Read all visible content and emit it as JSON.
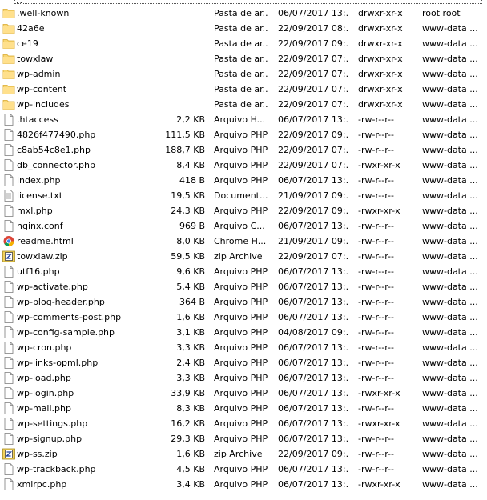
{
  "parent": {
    "label": ".."
  },
  "files": [
    {
      "name": ".well-known",
      "size": "",
      "type": "Pasta de ar...",
      "date": "06/07/2017 13:...",
      "perm": "drwxr-xr-x",
      "owner": "root root",
      "icon": "folder"
    },
    {
      "name": "42a6e",
      "size": "",
      "type": "Pasta de ar...",
      "date": "22/09/2017 08:...",
      "perm": "drwxr-xr-x",
      "owner": "www-data ...",
      "icon": "folder"
    },
    {
      "name": "ce19",
      "size": "",
      "type": "Pasta de ar...",
      "date": "22/09/2017 09:...",
      "perm": "drwxr-xr-x",
      "owner": "www-data ...",
      "icon": "folder"
    },
    {
      "name": "towxlaw",
      "size": "",
      "type": "Pasta de ar...",
      "date": "22/09/2017 07:...",
      "perm": "drwxr-xr-x",
      "owner": "www-data ...",
      "icon": "folder"
    },
    {
      "name": "wp-admin",
      "size": "",
      "type": "Pasta de ar...",
      "date": "22/09/2017 07:...",
      "perm": "drwxr-xr-x",
      "owner": "www-data ...",
      "icon": "folder"
    },
    {
      "name": "wp-content",
      "size": "",
      "type": "Pasta de ar...",
      "date": "22/09/2017 07:...",
      "perm": "drwxr-xr-x",
      "owner": "www-data ...",
      "icon": "folder"
    },
    {
      "name": "wp-includes",
      "size": "",
      "type": "Pasta de ar...",
      "date": "22/09/2017 07:...",
      "perm": "drwxr-xr-x",
      "owner": "www-data ...",
      "icon": "folder"
    },
    {
      "name": ".htaccess",
      "size": "2,2 KB",
      "type": "Arquivo H...",
      "date": "06/07/2017 13:...",
      "perm": "-rw-r--r--",
      "owner": "www-data ...",
      "icon": "file"
    },
    {
      "name": "4826f477490.php",
      "size": "111,5 KB",
      "type": "Arquivo PHP",
      "date": "22/09/2017 09:...",
      "perm": "-rw-r--r--",
      "owner": "www-data ...",
      "icon": "file"
    },
    {
      "name": "c8ab54c8e1.php",
      "size": "188,7 KB",
      "type": "Arquivo PHP",
      "date": "22/09/2017 07:...",
      "perm": "-rw-r--r--",
      "owner": "www-data ...",
      "icon": "file"
    },
    {
      "name": "db_connector.php",
      "size": "8,4 KB",
      "type": "Arquivo PHP",
      "date": "22/09/2017 07:...",
      "perm": "-rwxr-xr-x",
      "owner": "www-data ...",
      "icon": "file"
    },
    {
      "name": "index.php",
      "size": "418 B",
      "type": "Arquivo PHP",
      "date": "06/07/2017 13:...",
      "perm": "-rw-r--r--",
      "owner": "www-data ...",
      "icon": "file"
    },
    {
      "name": "license.txt",
      "size": "19,5 KB",
      "type": "Document...",
      "date": "21/09/2017 09:...",
      "perm": "-rw-r--r--",
      "owner": "www-data ...",
      "icon": "textfile"
    },
    {
      "name": "mxl.php",
      "size": "24,3 KB",
      "type": "Arquivo PHP",
      "date": "22/09/2017 09:...",
      "perm": "-rwxr-xr-x",
      "owner": "www-data ...",
      "icon": "file"
    },
    {
      "name": "nginx.conf",
      "size": "969 B",
      "type": "Arquivo C...",
      "date": "06/07/2017 13:...",
      "perm": "-rw-r--r--",
      "owner": "www-data ...",
      "icon": "file"
    },
    {
      "name": "readme.html",
      "size": "8,0 KB",
      "type": "Chrome H...",
      "date": "21/09/2017 09:...",
      "perm": "-rw-r--r--",
      "owner": "www-data ...",
      "icon": "chrome"
    },
    {
      "name": "towxlaw.zip",
      "size": "59,5 KB",
      "type": "zip Archive",
      "date": "22/09/2017 07:...",
      "perm": "-rw-r--r--",
      "owner": "www-data ...",
      "icon": "zip"
    },
    {
      "name": "utf16.php",
      "size": "9,6 KB",
      "type": "Arquivo PHP",
      "date": "06/07/2017 13:...",
      "perm": "-rw-r--r--",
      "owner": "www-data ...",
      "icon": "file"
    },
    {
      "name": "wp-activate.php",
      "size": "5,4 KB",
      "type": "Arquivo PHP",
      "date": "06/07/2017 13:...",
      "perm": "-rw-r--r--",
      "owner": "www-data ...",
      "icon": "file"
    },
    {
      "name": "wp-blog-header.php",
      "size": "364 B",
      "type": "Arquivo PHP",
      "date": "06/07/2017 13:...",
      "perm": "-rw-r--r--",
      "owner": "www-data ...",
      "icon": "file"
    },
    {
      "name": "wp-comments-post.php",
      "size": "1,6 KB",
      "type": "Arquivo PHP",
      "date": "06/07/2017 13:...",
      "perm": "-rw-r--r--",
      "owner": "www-data ...",
      "icon": "file"
    },
    {
      "name": "wp-config-sample.php",
      "size": "3,1 KB",
      "type": "Arquivo PHP",
      "date": "04/08/2017 09:...",
      "perm": "-rw-r--r--",
      "owner": "www-data ...",
      "icon": "file"
    },
    {
      "name": "wp-cron.php",
      "size": "3,3 KB",
      "type": "Arquivo PHP",
      "date": "06/07/2017 13:...",
      "perm": "-rw-r--r--",
      "owner": "www-data ...",
      "icon": "file"
    },
    {
      "name": "wp-links-opml.php",
      "size": "2,4 KB",
      "type": "Arquivo PHP",
      "date": "06/07/2017 13:...",
      "perm": "-rw-r--r--",
      "owner": "www-data ...",
      "icon": "file"
    },
    {
      "name": "wp-load.php",
      "size": "3,3 KB",
      "type": "Arquivo PHP",
      "date": "06/07/2017 13:...",
      "perm": "-rw-r--r--",
      "owner": "www-data ...",
      "icon": "file"
    },
    {
      "name": "wp-login.php",
      "size": "33,9 KB",
      "type": "Arquivo PHP",
      "date": "06/07/2017 13:...",
      "perm": "-rwxr-xr-x",
      "owner": "www-data ...",
      "icon": "file"
    },
    {
      "name": "wp-mail.php",
      "size": "8,3 KB",
      "type": "Arquivo PHP",
      "date": "06/07/2017 13:...",
      "perm": "-rw-r--r--",
      "owner": "www-data ...",
      "icon": "file"
    },
    {
      "name": "wp-settings.php",
      "size": "16,2 KB",
      "type": "Arquivo PHP",
      "date": "06/07/2017 13:...",
      "perm": "-rwxr-xr-x",
      "owner": "www-data ...",
      "icon": "file"
    },
    {
      "name": "wp-signup.php",
      "size": "29,3 KB",
      "type": "Arquivo PHP",
      "date": "06/07/2017 13:...",
      "perm": "-rw-r--r--",
      "owner": "www-data ...",
      "icon": "file"
    },
    {
      "name": "wp-ss.zip",
      "size": "1,6 KB",
      "type": "zip Archive",
      "date": "22/09/2017 09:...",
      "perm": "-rw-r--r--",
      "owner": "www-data ...",
      "icon": "zip"
    },
    {
      "name": "wp-trackback.php",
      "size": "4,5 KB",
      "type": "Arquivo PHP",
      "date": "06/07/2017 13:...",
      "perm": "-rw-r--r--",
      "owner": "www-data ...",
      "icon": "file"
    },
    {
      "name": "xmlrpc.php",
      "size": "3,4 KB",
      "type": "Arquivo PHP",
      "date": "06/07/2017 13:...",
      "perm": "-rwxr-xr-x",
      "owner": "www-data ...",
      "icon": "file"
    }
  ]
}
